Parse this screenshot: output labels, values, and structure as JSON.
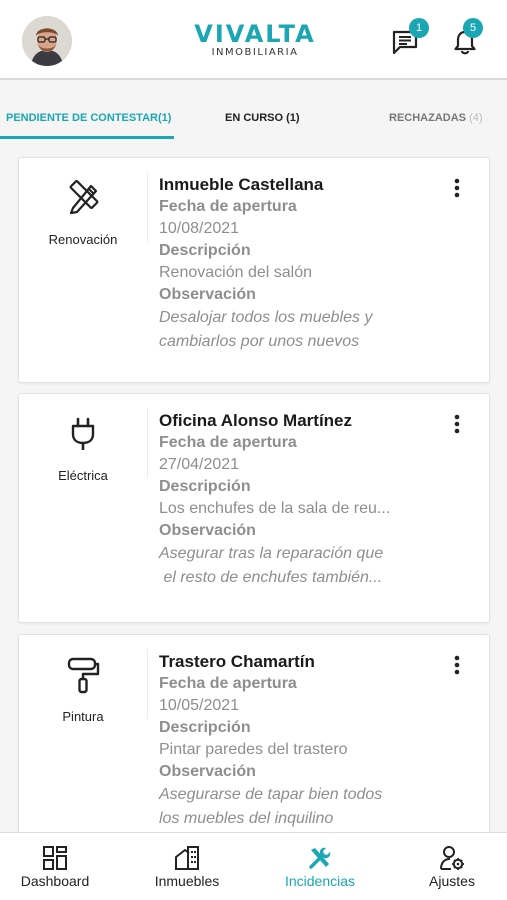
{
  "header": {
    "logo_main": "VIVALTA",
    "logo_sub": "INMOBILIARIA",
    "messages_badge": "1",
    "notifications_badge": "5",
    "accent": "#1aa7b3"
  },
  "tabs": [
    {
      "label": "PENDIENTE DE CONTESTAR(1)",
      "count": "",
      "active": true
    },
    {
      "label": "EN CURSO (1)",
      "count": "",
      "active": false
    },
    {
      "label": "RECHAZADAS",
      "count": "(4)",
      "active": false
    }
  ],
  "cards": [
    {
      "type_label": "Renovación",
      "type_icon": "tools-icon",
      "title": "Inmueble Castellana",
      "date_label": "Fecha de apertura",
      "date": "10/08/2021",
      "desc_label": "Descripción",
      "desc": "Renovación del salón",
      "obs_label": "Observación",
      "obs_line1": "Desalojar todos los muebles y",
      "obs_line2": "cambiarlos por unos nuevos"
    },
    {
      "type_label": "Eléctrica",
      "type_icon": "plug-icon",
      "title": "Oficina Alonso Martínez",
      "date_label": "Fecha de apertura",
      "date": "27/04/2021",
      "desc_label": "Descripción",
      "desc": "Los enchufes de la sala de reu...",
      "obs_label": "Observación",
      "obs_line1": "Asegurar tras la reparación que",
      "obs_line2": " el resto de enchufes también..."
    },
    {
      "type_label": "Pintura",
      "type_icon": "paint-roller-icon",
      "title": "Trastero Chamartín",
      "date_label": "Fecha de apertura",
      "date": "10/05/2021",
      "desc_label": "Descripción",
      "desc": "Pintar paredes del trastero",
      "obs_label": "Observación",
      "obs_line1": "Asegurarse de tapar bien todos",
      "obs_line2": "los muebles del inquilino"
    }
  ],
  "bottom_nav": [
    {
      "label": "Dashboard",
      "icon": "dashboard-icon",
      "active": false
    },
    {
      "label": "Inmuebles",
      "icon": "building-icon",
      "active": false
    },
    {
      "label": "Incidencias",
      "icon": "tools-icon",
      "active": true
    },
    {
      "label": "Ajustes",
      "icon": "user-settings-icon",
      "active": false
    }
  ]
}
